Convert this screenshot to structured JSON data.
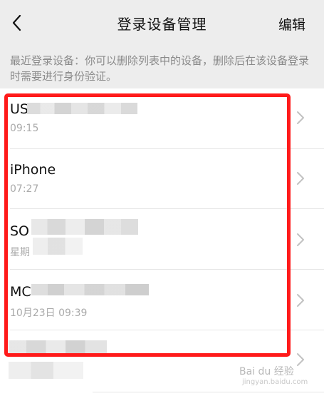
{
  "nav": {
    "back_icon": "chevron-left-icon",
    "title": "登录设备管理",
    "edit_label": "编辑"
  },
  "notice": "最近登录设备：你可以删除列表中的设备，删除后在该设备登录时需要进行身份验证。",
  "devices": [
    {
      "name": "US",
      "time": "09:15"
    },
    {
      "name": "iPhone",
      "time": "07:27"
    },
    {
      "name": "SO",
      "time": "星期"
    },
    {
      "name": "MC",
      "time": "10月23日 09:39"
    },
    {
      "name": "",
      "time": ""
    }
  ],
  "highlight_color": "#ff1a1a",
  "watermark": {
    "brand": "Bai du 经验",
    "url": "jingyan.baidu.com"
  }
}
